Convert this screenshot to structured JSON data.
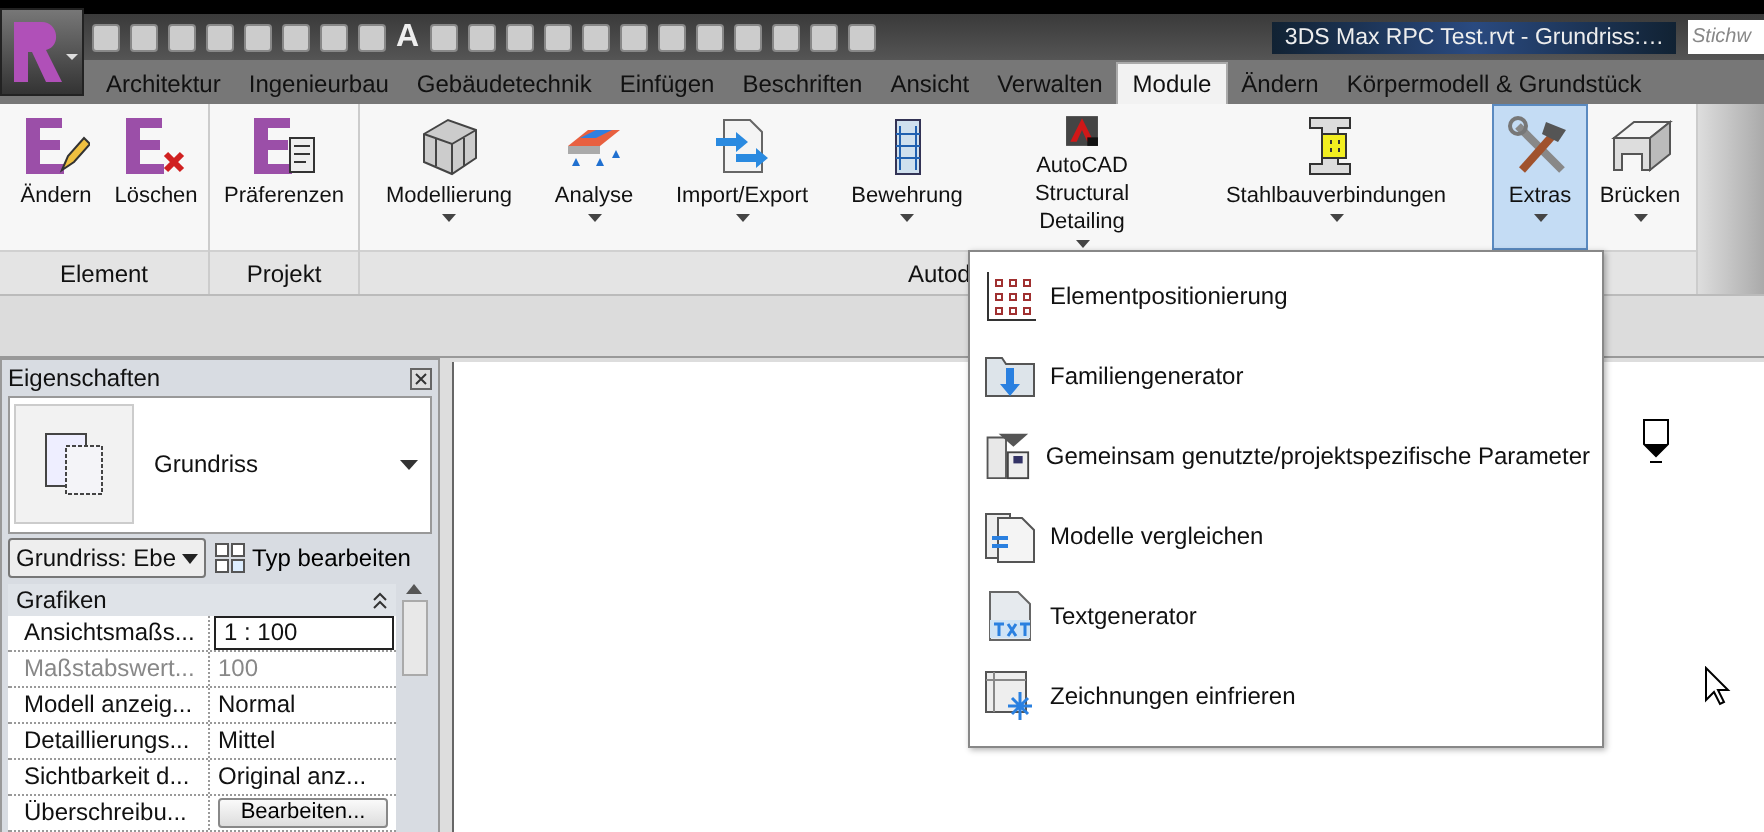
{
  "title_bar": {
    "quick_access_text_tool": "A",
    "document_title": "3DS Max RPC Test.rvt - Grundriss:…",
    "search": {
      "placeholder": "Stichw"
    }
  },
  "tabs": [
    {
      "label": "Architektur",
      "selected": false
    },
    {
      "label": "Ingenieurbau",
      "selected": false
    },
    {
      "label": "Gebäudetechnik",
      "selected": false
    },
    {
      "label": "Einfügen",
      "selected": false
    },
    {
      "label": "Beschriften",
      "selected": false
    },
    {
      "label": "Ansicht",
      "selected": false
    },
    {
      "label": "Verwalten",
      "selected": false
    },
    {
      "label": "Module",
      "selected": true
    },
    {
      "label": "Ändern",
      "selected": false
    },
    {
      "label": "Körpermodell & Grundstück",
      "selected": false
    }
  ],
  "ribbon": {
    "panels": [
      {
        "label": "Element",
        "buttons": [
          {
            "label": "Ändern",
            "dropdown": false,
            "selected": false
          },
          {
            "label": "Löschen",
            "dropdown": false,
            "selected": false
          }
        ]
      },
      {
        "label": "Projekt",
        "buttons": [
          {
            "label": "Präferenzen",
            "dropdown": false,
            "selected": false
          }
        ]
      },
      {
        "label": "Autod",
        "buttons": [
          {
            "label": "Modellierung",
            "dropdown": true,
            "selected": false
          },
          {
            "label": "Analyse",
            "dropdown": true,
            "selected": false
          },
          {
            "label": "Import/Export",
            "dropdown": true,
            "selected": false
          },
          {
            "label": "Bewehrung",
            "dropdown": true,
            "selected": false
          },
          {
            "label": "AutoCAD Structural Detailing",
            "dropdown": true,
            "selected": false
          },
          {
            "label": "Stahlbauverbindungen",
            "dropdown": true,
            "selected": false
          },
          {
            "label": "Extras",
            "dropdown": true,
            "selected": true
          },
          {
            "label": "Brücken",
            "dropdown": true,
            "selected": false
          }
        ]
      }
    ]
  },
  "extras_menu": {
    "items": [
      {
        "label": "Elementpositionierung"
      },
      {
        "label": "Familiengenerator"
      },
      {
        "label": "Gemeinsam genutzte/projektspezifische Parameter"
      },
      {
        "label": "Modelle vergleichen"
      },
      {
        "label": "Textgenerator"
      },
      {
        "label": "Zeichnungen einfrieren"
      }
    ]
  },
  "properties": {
    "title": "Eigenschaften",
    "type_name": "Grundriss",
    "type_filter": "Grundriss: Ebe",
    "edit_type": "Typ bearbeiten",
    "group": "Grafiken",
    "rows": [
      {
        "name": "Ansichtsmaßs...",
        "value": "1 : 100",
        "kind": "field",
        "disabled": false
      },
      {
        "name": "Maßstabswert...",
        "value": "100",
        "kind": "text",
        "disabled": true
      },
      {
        "name": "Modell anzeig...",
        "value": "Normal",
        "kind": "text",
        "disabled": false
      },
      {
        "name": "Detaillierungs...",
        "value": "Mittel",
        "kind": "text",
        "disabled": false
      },
      {
        "name": "Sichtbarkeit d...",
        "value": "Original anz...",
        "kind": "text",
        "disabled": false
      },
      {
        "name": "Überschreibu...",
        "value": "Bearbeiten...",
        "kind": "button",
        "disabled": false
      }
    ]
  }
}
